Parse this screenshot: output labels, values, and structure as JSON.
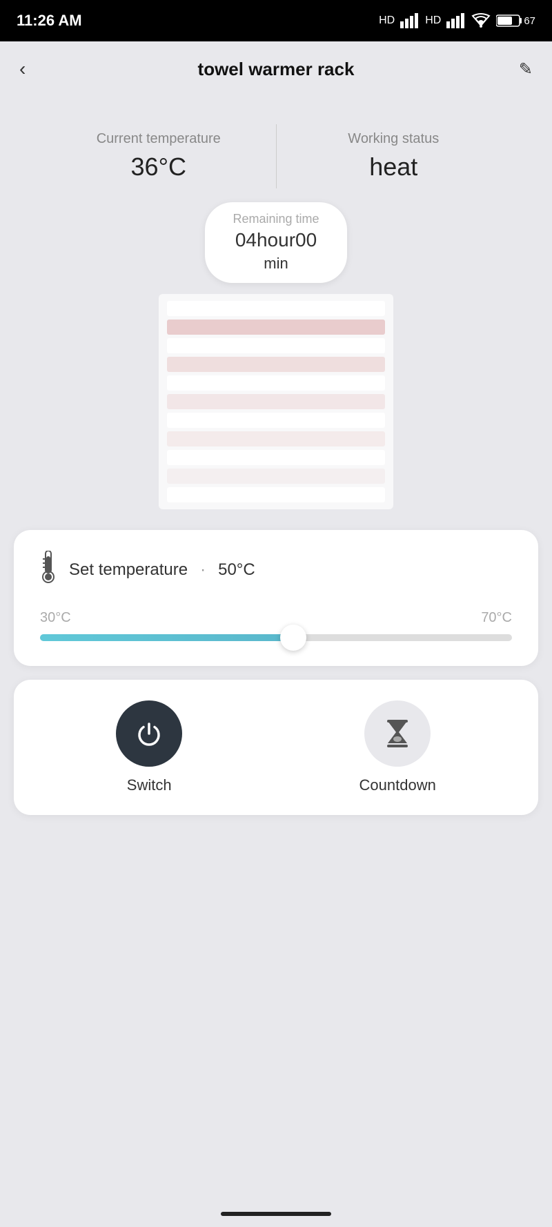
{
  "statusBar": {
    "time": "11:26 AM",
    "battery": "67"
  },
  "header": {
    "back_icon": "‹",
    "title": "towel warmer rack",
    "edit_icon": "✎"
  },
  "stats": {
    "current_temp_label": "Current temperature",
    "current_temp_value": "36°C",
    "working_status_label": "Working status",
    "working_status_value": "heat"
  },
  "remaining": {
    "label": "Remaining time",
    "value": "04hour00",
    "unit": "min"
  },
  "temperature_card": {
    "title": "Set temperature",
    "dot": "·",
    "value": "50°C",
    "min_label": "30°C",
    "max_label": "70°C",
    "slider_percent": 52
  },
  "controls": {
    "switch_label": "Switch",
    "countdown_label": "Countdown"
  }
}
